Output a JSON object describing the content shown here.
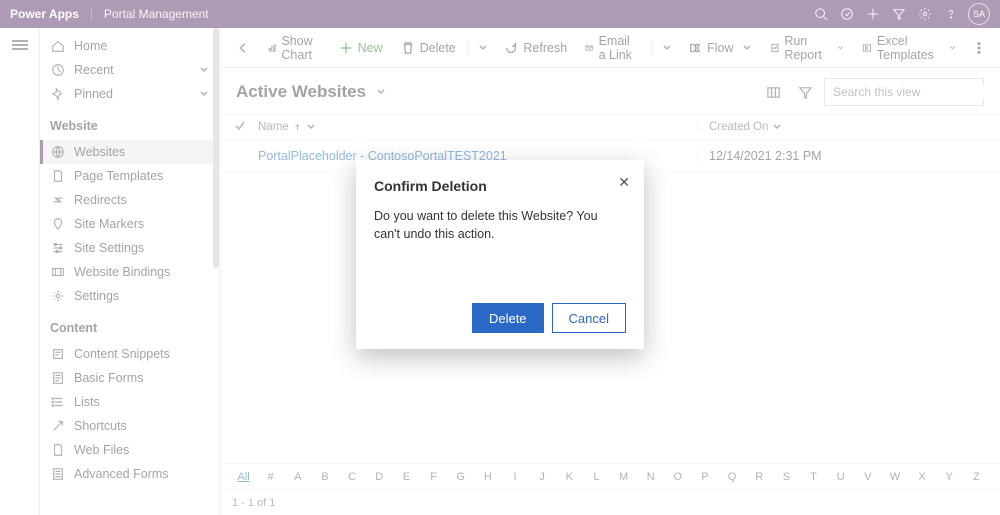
{
  "topbar": {
    "logo": "Power Apps",
    "app": "Portal Management",
    "avatar": "SA"
  },
  "sidebar": {
    "nav": [
      {
        "key": "home",
        "label": "Home",
        "icon": "home"
      },
      {
        "key": "recent",
        "label": "Recent",
        "icon": "clock",
        "chev": true
      },
      {
        "key": "pinned",
        "label": "Pinned",
        "icon": "pin",
        "chev": true
      }
    ],
    "section_website": "Website",
    "website": [
      {
        "key": "websites",
        "label": "Websites",
        "icon": "globe",
        "selected": true
      },
      {
        "key": "pagetemplates",
        "label": "Page Templates",
        "icon": "page"
      },
      {
        "key": "redirects",
        "label": "Redirects",
        "icon": "redirect"
      },
      {
        "key": "sitemarkers",
        "label": "Site Markers",
        "icon": "marker"
      },
      {
        "key": "sitesettings",
        "label": "Site Settings",
        "icon": "sliders"
      },
      {
        "key": "websitebindings",
        "label": "Website Bindings",
        "icon": "bind"
      },
      {
        "key": "settings",
        "label": "Settings",
        "icon": "gear"
      }
    ],
    "section_content": "Content",
    "content": [
      {
        "key": "contentsnippets",
        "label": "Content Snippets",
        "icon": "snippet"
      },
      {
        "key": "basicforms",
        "label": "Basic Forms",
        "icon": "form"
      },
      {
        "key": "lists",
        "label": "Lists",
        "icon": "list"
      },
      {
        "key": "shortcuts",
        "label": "Shortcuts",
        "icon": "shortcut"
      },
      {
        "key": "webfiles",
        "label": "Web Files",
        "icon": "file"
      },
      {
        "key": "advancedforms",
        "label": "Advanced Forms",
        "icon": "aform"
      }
    ]
  },
  "commandbar": {
    "show_chart": "Show Chart",
    "new": "New",
    "delete": "Delete",
    "refresh": "Refresh",
    "email": "Email a Link",
    "flow": "Flow",
    "run_report": "Run Report",
    "excel": "Excel Templates"
  },
  "view": {
    "title": "Active Websites",
    "search_placeholder": "Search this view"
  },
  "grid": {
    "columns": {
      "name": "Name",
      "created": "Created On"
    },
    "rows": [
      {
        "name": "PortalPlaceholder - ContosoPortalTEST2021",
        "created": "12/14/2021 2:31 PM"
      }
    ],
    "alpha_all": "All",
    "alpha": [
      "#",
      "A",
      "B",
      "C",
      "D",
      "E",
      "F",
      "G",
      "H",
      "I",
      "J",
      "K",
      "L",
      "M",
      "N",
      "O",
      "P",
      "Q",
      "R",
      "S",
      "T",
      "U",
      "V",
      "W",
      "X",
      "Y",
      "Z"
    ],
    "pager": "1 - 1 of 1"
  },
  "dialog": {
    "title": "Confirm Deletion",
    "body": "Do you want to delete this Website? You can't undo this action.",
    "delete": "Delete",
    "cancel": "Cancel"
  }
}
